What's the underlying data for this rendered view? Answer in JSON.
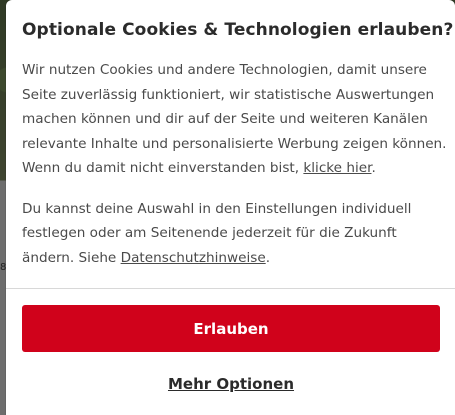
{
  "background": {
    "peek_text": "8"
  },
  "dialog": {
    "title": "Optionale Cookies & Technologien erlauben?",
    "paragraph1": {
      "text": "Wir nutzen Cookies und andere Technologien, damit unsere Seite zuverlässig funktioniert, wir statistische Auswertungen machen können und dir auf der Seite und weiteren Kanälen relevante Inhalte und personalisierte Werbung zeigen können. Wenn du damit nicht einverstanden bist, ",
      "link": "klicke hier",
      "after": "."
    },
    "paragraph2": {
      "text": "Du kannst deine Auswahl in den Einstellungen individuell festlegen oder am Seitenende jederzeit für die Zukunft ändern. Siehe ",
      "link": "Datenschutzhinweise",
      "after": "."
    },
    "primary_button": "Erlauben",
    "secondary_link": "Mehr Optionen"
  },
  "colors": {
    "accent": "#d0021b",
    "title_text": "#2b2b2b",
    "body_text": "#4a4a4a",
    "divider": "#d8d8d8"
  }
}
